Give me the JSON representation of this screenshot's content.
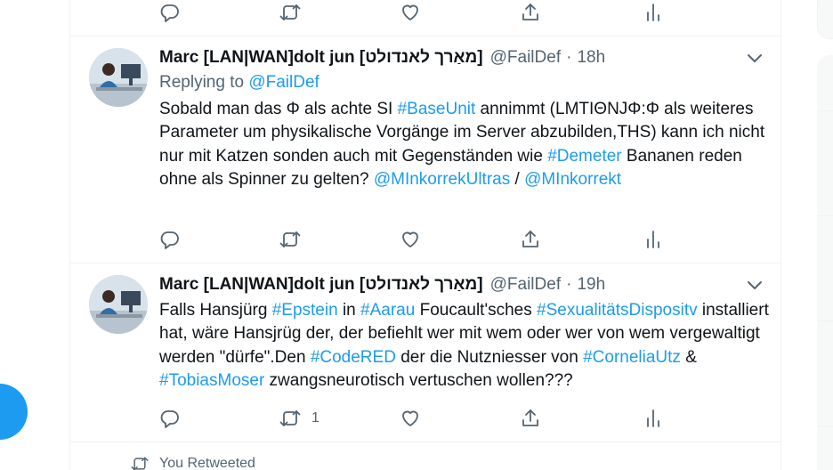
{
  "top_actions": {
    "reply": "",
    "retweet": "",
    "like": ""
  },
  "tweets": [
    {
      "name": "Marc [LAN|WAN]dolt jun [מאַרך לאנדולט]",
      "handle": "@FailDef",
      "separator": "·",
      "time": "18h",
      "replying_prefix": "Replying to",
      "replying_to": "@FailDef",
      "body": [
        {
          "t": "Sobald man das Φ als achte SI "
        },
        {
          "t": "#BaseUnit",
          "link": true
        },
        {
          "t": " annimmt  (LMTIΘNJΦ:Φ als weiteres Parameter um physikalische Vorgänge im Server abzubilden,THS) kann ich nicht nur mit Katzen sonden auch mit Gegenständen wie "
        },
        {
          "t": "#Demeter",
          "link": true
        },
        {
          "t": " Bananen reden ohne als Spinner zu gelten? "
        },
        {
          "t": "@MInkorrekUltras",
          "link": true
        },
        {
          "t": " / "
        },
        {
          "t": "@MInkorrekt",
          "link": true
        }
      ],
      "retweet_count": "",
      "avatar": "person-at-desk"
    },
    {
      "name": "Marc [LAN|WAN]dolt jun [מאַרך לאנדולט]",
      "handle": "@FailDef",
      "separator": "·",
      "time": "19h",
      "body": [
        {
          "t": "Falls Hansjürg "
        },
        {
          "t": "#Epstein",
          "link": true
        },
        {
          "t": " in "
        },
        {
          "t": "#Aarau",
          "link": true
        },
        {
          "t": " Foucault'sches "
        },
        {
          "t": "#SexualitätsDispositv",
          "link": true
        },
        {
          "t": " installiert hat, wäre Hansjrüg der, der befiehlt wer mit wem oder wer von wem vergewaltigt werden \"dürfe\".Den "
        },
        {
          "t": "#CodeRED",
          "link": true
        },
        {
          "t": " der die Nutzniesser von "
        },
        {
          "t": "#CorneliaUtz",
          "link": true
        },
        {
          "t": " & "
        },
        {
          "t": "#TobiasMoser",
          "link": true
        },
        {
          "t": " zwangsneurotisch vertuschen wollen???"
        }
      ],
      "retweet_count": "1",
      "avatar": "person-at-desk"
    }
  ],
  "retweeted_note": "You Retweeted",
  "colors": {
    "accent": "#1d9bf0",
    "muted": "#536471",
    "text": "#0f1419",
    "border": "#eff3f4"
  }
}
